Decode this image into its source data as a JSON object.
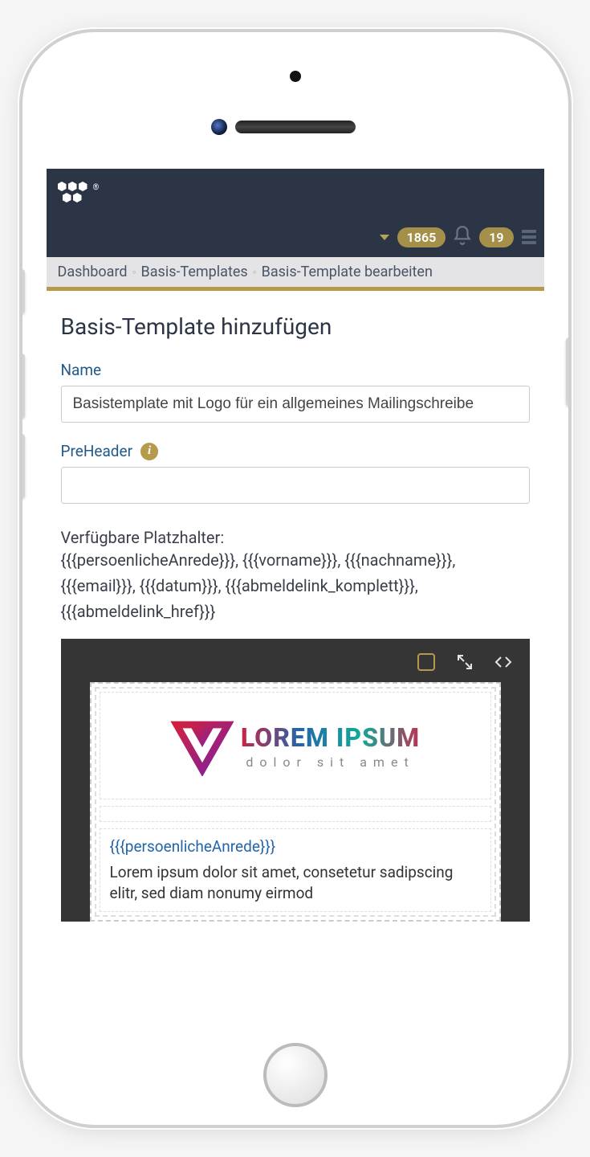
{
  "header": {
    "badge1": "1865",
    "badge2": "19"
  },
  "breadcrumb": {
    "items": [
      "Dashboard",
      "Basis-Templates",
      "Basis-Template bearbeiten"
    ]
  },
  "page": {
    "title": "Basis-Template hinzufügen"
  },
  "fields": {
    "name": {
      "label": "Name",
      "value": "Basistemplate mit Logo für ein allgemeines Mailingschreibe"
    },
    "preheader": {
      "label": "PreHeader",
      "value": ""
    }
  },
  "placeholders": {
    "label": "Verfügbare Platzhalter:",
    "list": "{{{persoenlicheAnrede}}}, {{{vorname}}}, {{{nachname}}}, {{{email}}}, {{{datum}}}, {{{abmeldelink_komplett}}}, {{{abmeldelink_href}}}"
  },
  "editor": {
    "logo": {
      "line1": "LOREM IPSUM",
      "line2": "dolor sit amet"
    },
    "content": {
      "placeholder": "{{{persoenlicheAnrede}}}",
      "body": "Lorem ipsum dolor sit amet, consetetur sadipscing elitr, sed diam nonumy eirmod"
    }
  }
}
